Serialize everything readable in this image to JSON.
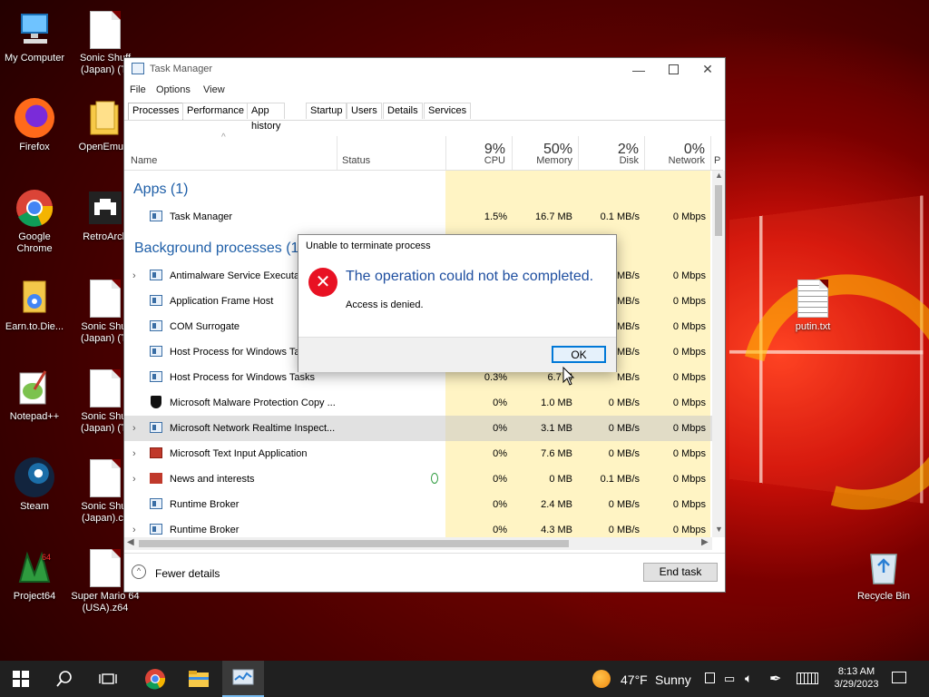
{
  "desktop": {
    "icons": [
      {
        "label": "My Computer",
        "icon": "computer-icon"
      },
      {
        "label": "Sonic Shuff (Japan) (Tr",
        "icon": "file-icon"
      },
      {
        "label": "Firefox",
        "icon": "firefox-icon"
      },
      {
        "label": "OpenEmu.a",
        "icon": "folder-icon"
      },
      {
        "label": "Google Chrome",
        "icon": "chrome-icon"
      },
      {
        "label": "RetroArch",
        "icon": "retroarch-icon"
      },
      {
        "label": "Earn.to.Die...",
        "icon": "zip-icon"
      },
      {
        "label": "Sonic Shuf (Japan) (Tr",
        "icon": "file-icon"
      },
      {
        "label": "Notepad++",
        "icon": "notepadpp-icon"
      },
      {
        "label": "Sonic Shuf (Japan) (Tr",
        "icon": "file-icon"
      },
      {
        "label": "Steam",
        "icon": "steam-icon"
      },
      {
        "label": "Sonic Shuf (Japan).cu",
        "icon": "file-icon"
      },
      {
        "label": "Project64",
        "icon": "project64-icon"
      },
      {
        "label": "Super Mario 64 (USA).z64",
        "icon": "file-icon"
      },
      {
        "label": "putin.txt",
        "icon": "text-file-icon"
      },
      {
        "label": "Recycle Bin",
        "icon": "recycle-bin-icon"
      }
    ]
  },
  "taskmgr": {
    "title": "Task Manager",
    "menu": [
      "File",
      "Options",
      "View"
    ],
    "tabs": [
      "Processes",
      "Performance",
      "App history",
      "Startup",
      "Users",
      "Details",
      "Services"
    ],
    "columns": {
      "name": "Name",
      "status": "Status",
      "cpu": {
        "pct": "9%",
        "label": "CPU"
      },
      "memory": {
        "pct": "50%",
        "label": "Memory"
      },
      "disk": {
        "pct": "2%",
        "label": "Disk"
      },
      "network": {
        "pct": "0%",
        "label": "Network"
      },
      "power": "P"
    },
    "groups": {
      "apps": "Apps (1)",
      "background": "Background processes (1"
    },
    "apps_row": {
      "name": "Task Manager",
      "cpu": "1.5%",
      "memory": "16.7 MB",
      "disk": "0.1 MB/s",
      "network": "0 Mbps"
    },
    "rows": [
      {
        "name": "Antimalware Service Executab",
        "cpu": "",
        "memory": "",
        "disk": "MB/s",
        "network": "0 Mbps",
        "expand": true
      },
      {
        "name": "Application Frame Host",
        "cpu": "",
        "memory": "",
        "disk": "MB/s",
        "network": "0 Mbps",
        "expand": false
      },
      {
        "name": "COM Surrogate",
        "cpu": "",
        "memory": "",
        "disk": "MB/s",
        "network": "0 Mbps",
        "expand": false
      },
      {
        "name": "Host Process for Windows Ta",
        "cpu": "",
        "memory": "",
        "disk": "MB/s",
        "network": "0 Mbps",
        "expand": false
      },
      {
        "name": "Host Process for Windows Tasks",
        "cpu": "0.3%",
        "memory": "6.7 M",
        "disk": "MB/s",
        "network": "0 Mbps",
        "expand": false
      },
      {
        "name": "Microsoft Malware Protection Copy ...",
        "cpu": "0%",
        "memory": "1.0 MB",
        "disk": "0 MB/s",
        "network": "0 Mbps",
        "expand": false
      },
      {
        "name": "Microsoft Network Realtime Inspect...",
        "cpu": "0%",
        "memory": "3.1 MB",
        "disk": "0 MB/s",
        "network": "0 Mbps",
        "expand": true
      },
      {
        "name": "Microsoft Text Input Application",
        "cpu": "0%",
        "memory": "7.6 MB",
        "disk": "0 MB/s",
        "network": "0 Mbps",
        "expand": true
      },
      {
        "name": "News and interests",
        "cpu": "0%",
        "memory": "0 MB",
        "disk": "0.1 MB/s",
        "network": "0 Mbps",
        "expand": true
      },
      {
        "name": "Runtime Broker",
        "cpu": "0%",
        "memory": "2.4 MB",
        "disk": "0 MB/s",
        "network": "0 Mbps",
        "expand": false
      },
      {
        "name": "Runtime Broker",
        "cpu": "0%",
        "memory": "4.3 MB",
        "disk": "0 MB/s",
        "network": "0 Mbps",
        "expand": true
      }
    ],
    "fewer_details": "Fewer details",
    "end_task": "End task"
  },
  "dialog": {
    "title": "Unable to terminate process",
    "main": "The operation could not be completed.",
    "detail": "Access is denied.",
    "ok": "OK"
  },
  "taskbar": {
    "weather_temp": "47°F",
    "weather_text": "Sunny",
    "time": "8:13 AM",
    "date": "3/29/2023"
  },
  "colors": {
    "accent": "#0078d7",
    "group": "#1f5fa8",
    "yellow": "#fff4c4",
    "error": "#e81123"
  }
}
